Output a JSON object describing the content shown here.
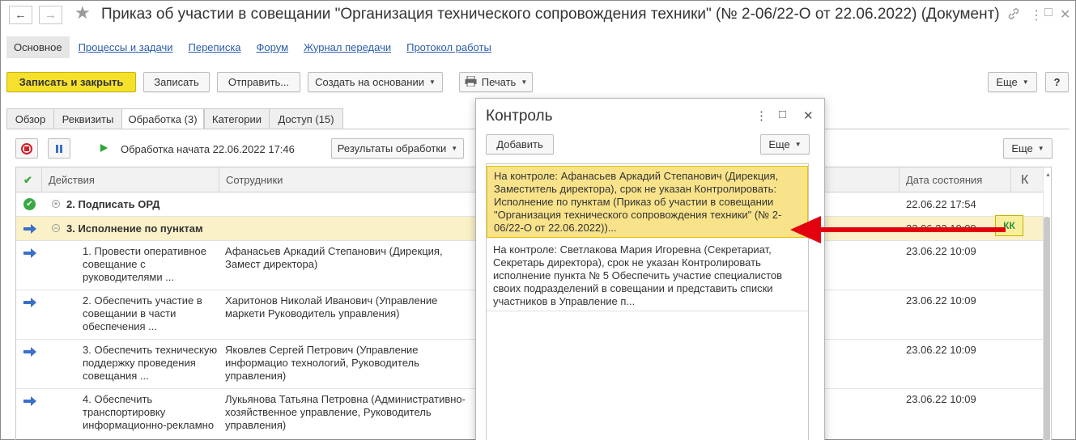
{
  "window": {
    "title": "Приказ об участии в совещании \"Организация технического сопровождения техники\" (№ 2-06/22-О от 22.06.2022) (Документ)",
    "back_icon": "←",
    "forward_icon": "→",
    "star_icon": "★",
    "link_icon": "🔗",
    "menu_icon": "⋮",
    "maximize_icon": "□",
    "close_icon": "✕"
  },
  "sections": {
    "main": "Основное",
    "links": [
      "Процессы и задачи",
      "Переписка",
      "Форум",
      "Журнал передачи",
      "Протокол работы"
    ]
  },
  "toolbar": {
    "save_close": "Записать и закрыть",
    "save": "Записать",
    "send": "Отправить...",
    "create_based": "Создать на основании",
    "print": "Печать",
    "more": "Еще",
    "help": "?"
  },
  "tabs": [
    "Обзор",
    "Реквизиты",
    "Обработка (3)",
    "Категории",
    "Доступ (15)"
  ],
  "process": {
    "status": "Обработка начата 22.06.2022 17:46",
    "results": "Результаты обработки",
    "more": "Еще"
  },
  "table": {
    "columns": [
      "Действия",
      "Сотрудники",
      "Дата состояния",
      "К"
    ],
    "rows": [
      {
        "action": "2. Подписать ОРД",
        "employee": "",
        "date": "22.06.22 17:54"
      },
      {
        "action": "3. Исполнение по пунктам",
        "employee": "",
        "date": "23.06.22 10:09"
      },
      {
        "action": "1. Провести оперативное совещание с руководителями ...",
        "employee": "Афанасьев Аркадий Степанович (Дирекция, Замест директора)",
        "date": "23.06.22 10:09"
      },
      {
        "action": "2. Обеспечить участие в совещании в части обеспечения ...",
        "employee": "Харитонов Николай Иванович (Управление маркети Руководитель управления)",
        "date": "23.06.22 10:09"
      },
      {
        "action": "3. Обеспечить техническую поддержку проведения совещания ...",
        "employee": "Яковлев Сергей Петрович (Управление информацио технологий, Руководитель управления)",
        "date": "23.06.22 10:09"
      },
      {
        "action": "4. Обеспечить транспортировку информационно-рекламно",
        "employee": "Лукьянова Татьяна Петровна (Административно-хозяйственное управление, Руководитель управления)",
        "date": "23.06.22 10:09"
      }
    ],
    "badge": "КК"
  },
  "popup": {
    "title": "Контроль",
    "add": "Добавить",
    "more": "Еще",
    "items": [
      "На контроле: Афанасьев Аркадий Степанович (Дирекция, Заместитель директора), срок не указан Контролировать: Исполнение по пунктам (Приказ об участии в совещании \"Организация технического сопровождения техники\" (№ 2-06/22-О от 22.06.2022))...",
      "На контроле: Светлакова Мария Игоревна (Секретариат, Секретарь директора), срок не указан Контролировать исполнение пункта № 5 Обеспечить участие специалистов своих подразделений в совещании и представить списки участников в Управление п..."
    ]
  },
  "colors": {
    "primary_button": "#f5e02e",
    "highlight_row": "#faf1c9",
    "selected_item": "#f9e38a",
    "link": "#2a5ca8",
    "arrow": "#e3000f"
  }
}
